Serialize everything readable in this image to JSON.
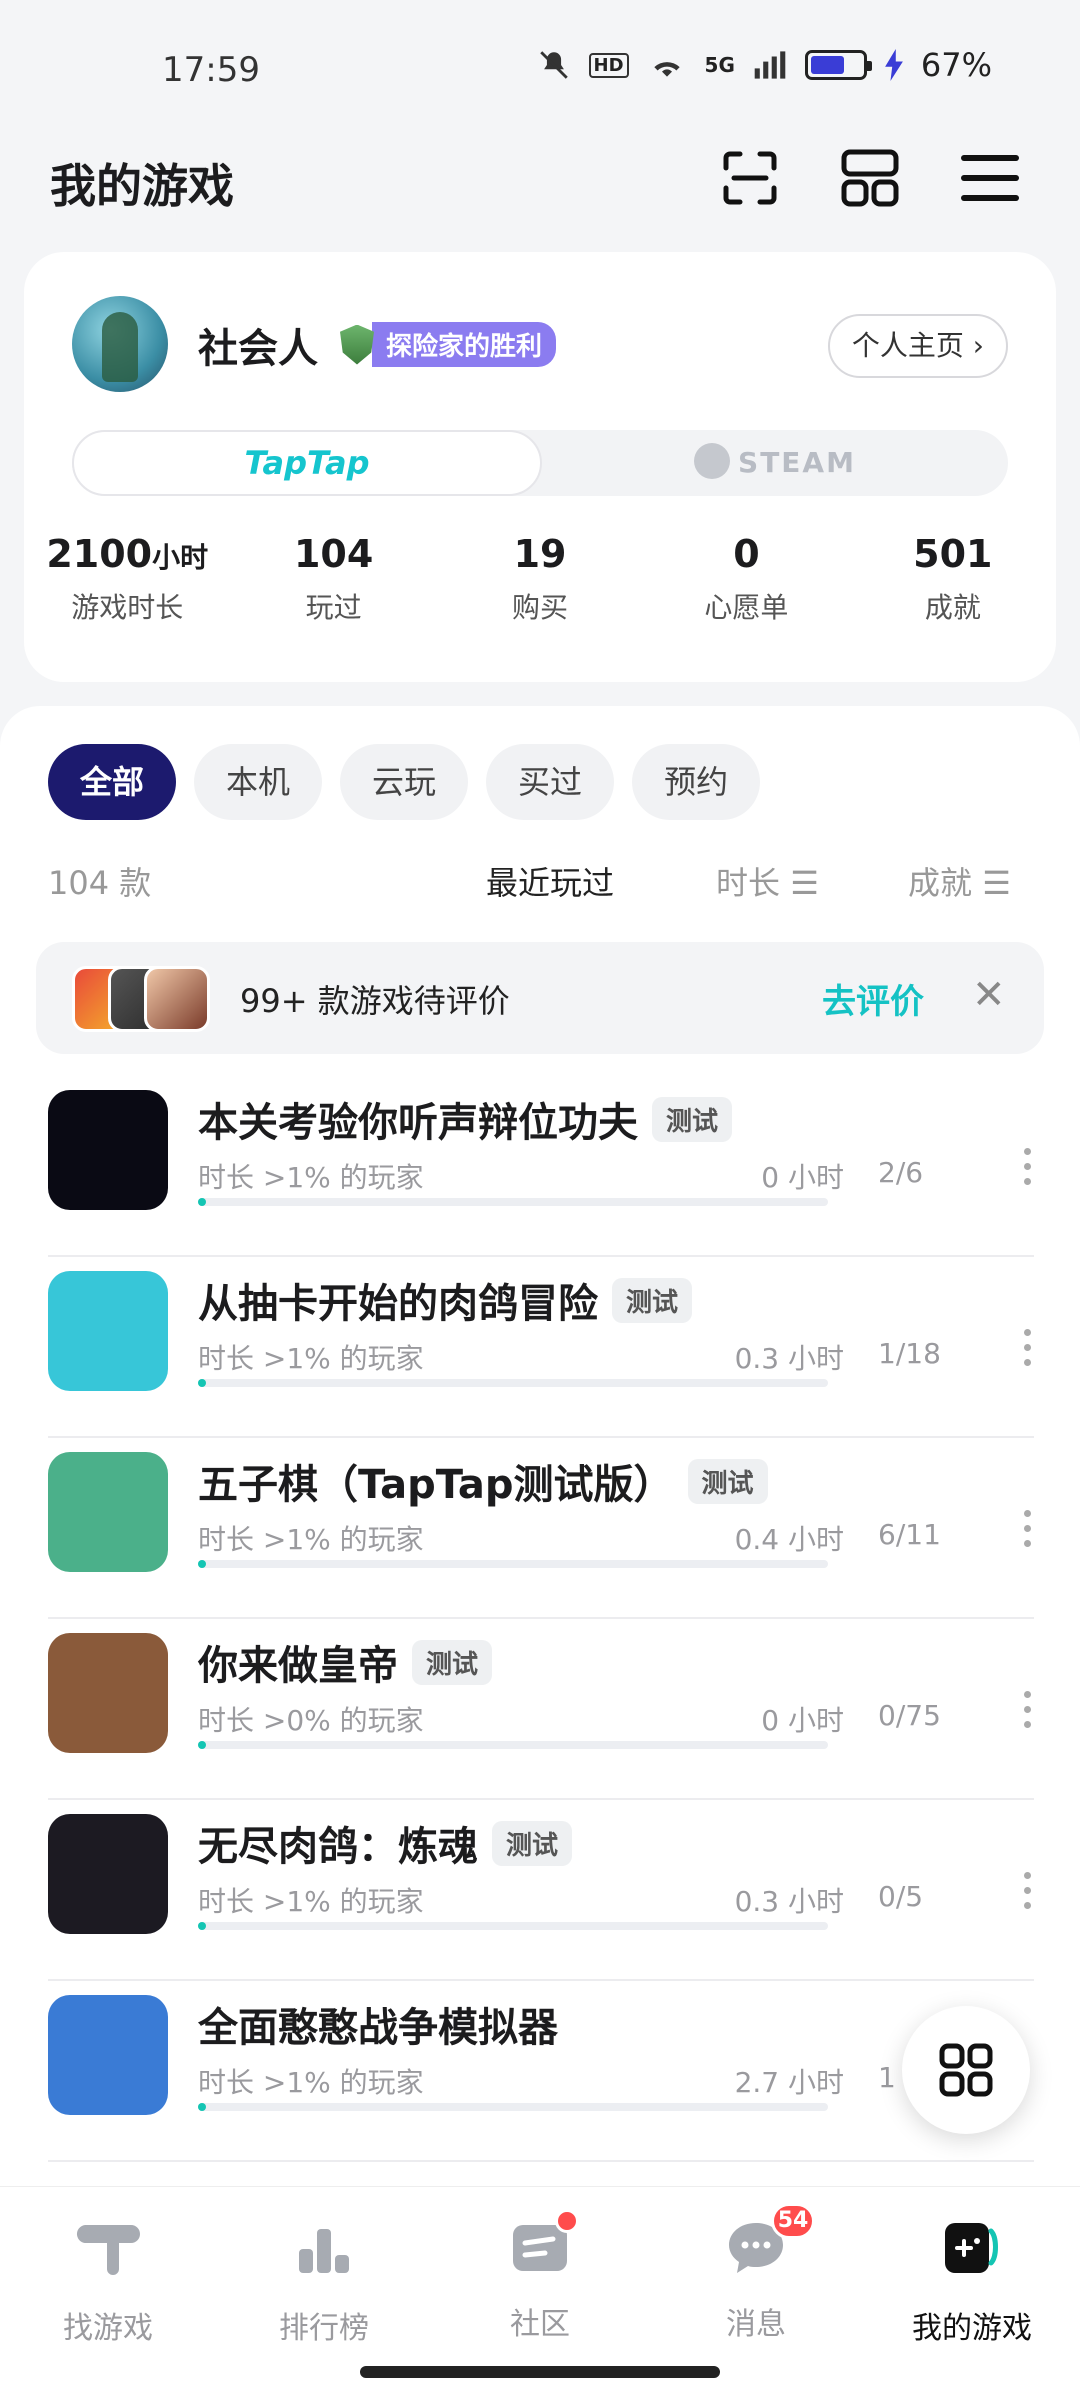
{
  "status_bar": {
    "time": "17:59",
    "network": "5G",
    "hd": "HD",
    "battery_percent": "67%",
    "battery_level": 0.67
  },
  "header": {
    "title": "我的游戏",
    "icons": [
      "scan-icon",
      "widgets-icon",
      "menu-icon"
    ]
  },
  "profile": {
    "username": "社会人",
    "badge": "探险家的胜利",
    "profile_link": "个人主页",
    "platform_toggle": {
      "active": "TapTap",
      "inactive": "STEAM"
    },
    "stats": [
      {
        "value": "2100",
        "unit": "小时",
        "label": "游戏时长"
      },
      {
        "value": "104",
        "unit": "",
        "label": "玩过"
      },
      {
        "value": "19",
        "unit": "",
        "label": "购买"
      },
      {
        "value": "0",
        "unit": "",
        "label": "心愿单"
      },
      {
        "value": "501",
        "unit": "",
        "label": "成就"
      }
    ]
  },
  "filters": {
    "items": [
      "全部",
      "本机",
      "云玩",
      "买过",
      "预约"
    ],
    "active": "全部"
  },
  "sort": {
    "count": "104 款",
    "options": [
      "最近玩过",
      "时长",
      "成就"
    ],
    "active": "最近玩过"
  },
  "review_banner": {
    "text": "99+ 款游戏待评价",
    "action": "去评价"
  },
  "games": [
    {
      "title": "本关考验你听声辩位功夫",
      "tag": "测试",
      "subtitle": "时长 >1% 的玩家",
      "hours": "0 小时",
      "achievements": "2/6",
      "progress": 0.01,
      "icon_color": "#0a0a14"
    },
    {
      "title": "从抽卡开始的肉鸽冒险",
      "tag": "测试",
      "subtitle": "时长 >1% 的玩家",
      "hours": "0.3 小时",
      "achievements": "1/18",
      "progress": 0.01,
      "icon_color": "#37c6d8"
    },
    {
      "title": "五子棋（TapTap测试版）",
      "tag": "测试",
      "subtitle": "时长 >1% 的玩家",
      "hours": "0.4 小时",
      "achievements": "6/11",
      "progress": 0.01,
      "icon_color": "#4bb08a"
    },
    {
      "title": "你来做皇帝",
      "tag": "测试",
      "subtitle": "时长 >0% 的玩家",
      "hours": "0 小时",
      "achievements": "0/75",
      "progress": 0.005,
      "icon_color": "#8a5a3a"
    },
    {
      "title": "无尽肉鸽：炼魂",
      "tag": "测试",
      "subtitle": "时长 >1% 的玩家",
      "hours": "0.3 小时",
      "achievements": "0/5",
      "progress": 0.01,
      "icon_color": "#1c1a22"
    },
    {
      "title": "全面憨憨战争模拟器",
      "tag": "",
      "subtitle": "时长 >1% 的玩家",
      "hours": "2.7 小时",
      "achievements": "1",
      "progress": 0.01,
      "icon_color": "#3a7bd5"
    }
  ],
  "fab": {
    "icon": "grid-icon"
  },
  "bottom_nav": [
    {
      "label": "找游戏",
      "icon": "taptap-icon",
      "badge": ""
    },
    {
      "label": "排行榜",
      "icon": "ranking-icon",
      "badge": ""
    },
    {
      "label": "社区",
      "icon": "community-icon",
      "badge": "dot"
    },
    {
      "label": "消息",
      "icon": "message-icon",
      "badge": "54"
    },
    {
      "label": "我的游戏",
      "icon": "gamepad-icon",
      "badge": ""
    }
  ],
  "colors": {
    "accent": "#14c5b3",
    "chip_active": "#1c1a6e",
    "badge": "#8b7cf0",
    "notification": "#ff4c4c"
  }
}
